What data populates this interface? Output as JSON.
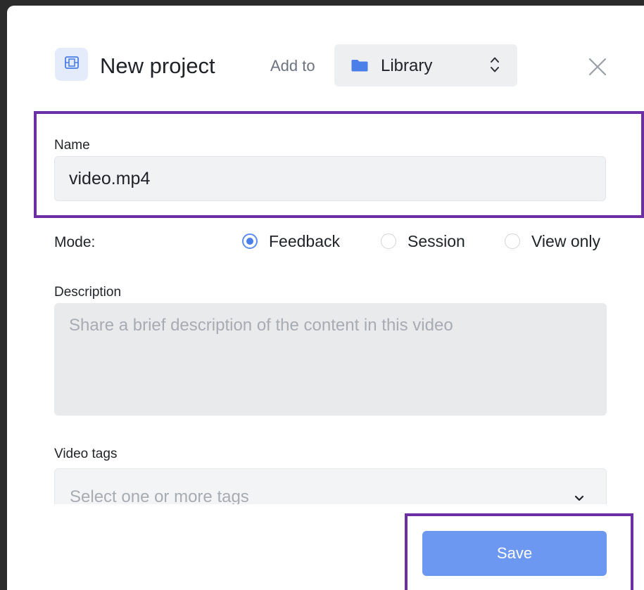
{
  "header": {
    "title": "New project",
    "add_to_label": "Add to",
    "folder_select": {
      "value": "Library",
      "icon": "folder-icon"
    },
    "project_icon": "film-icon",
    "close_icon": "close-icon"
  },
  "form": {
    "name": {
      "label": "Name",
      "value": "video.mp4"
    },
    "mode": {
      "label": "Mode:",
      "options": [
        {
          "label": "Feedback",
          "selected": true
        },
        {
          "label": "Session",
          "selected": false
        },
        {
          "label": "View only",
          "selected": false
        }
      ]
    },
    "description": {
      "label": "Description",
      "placeholder": "Share a brief description of the content in this video",
      "value": ""
    },
    "video_tags": {
      "label": "Video tags",
      "placeholder": "Select one or more tags"
    }
  },
  "footer": {
    "save_label": "Save"
  },
  "colors": {
    "accent": "#6d98f2",
    "radio_selected": "#4a7ee8",
    "highlight": "#6b2fa3",
    "icon_tile": "#e4ebfb"
  }
}
